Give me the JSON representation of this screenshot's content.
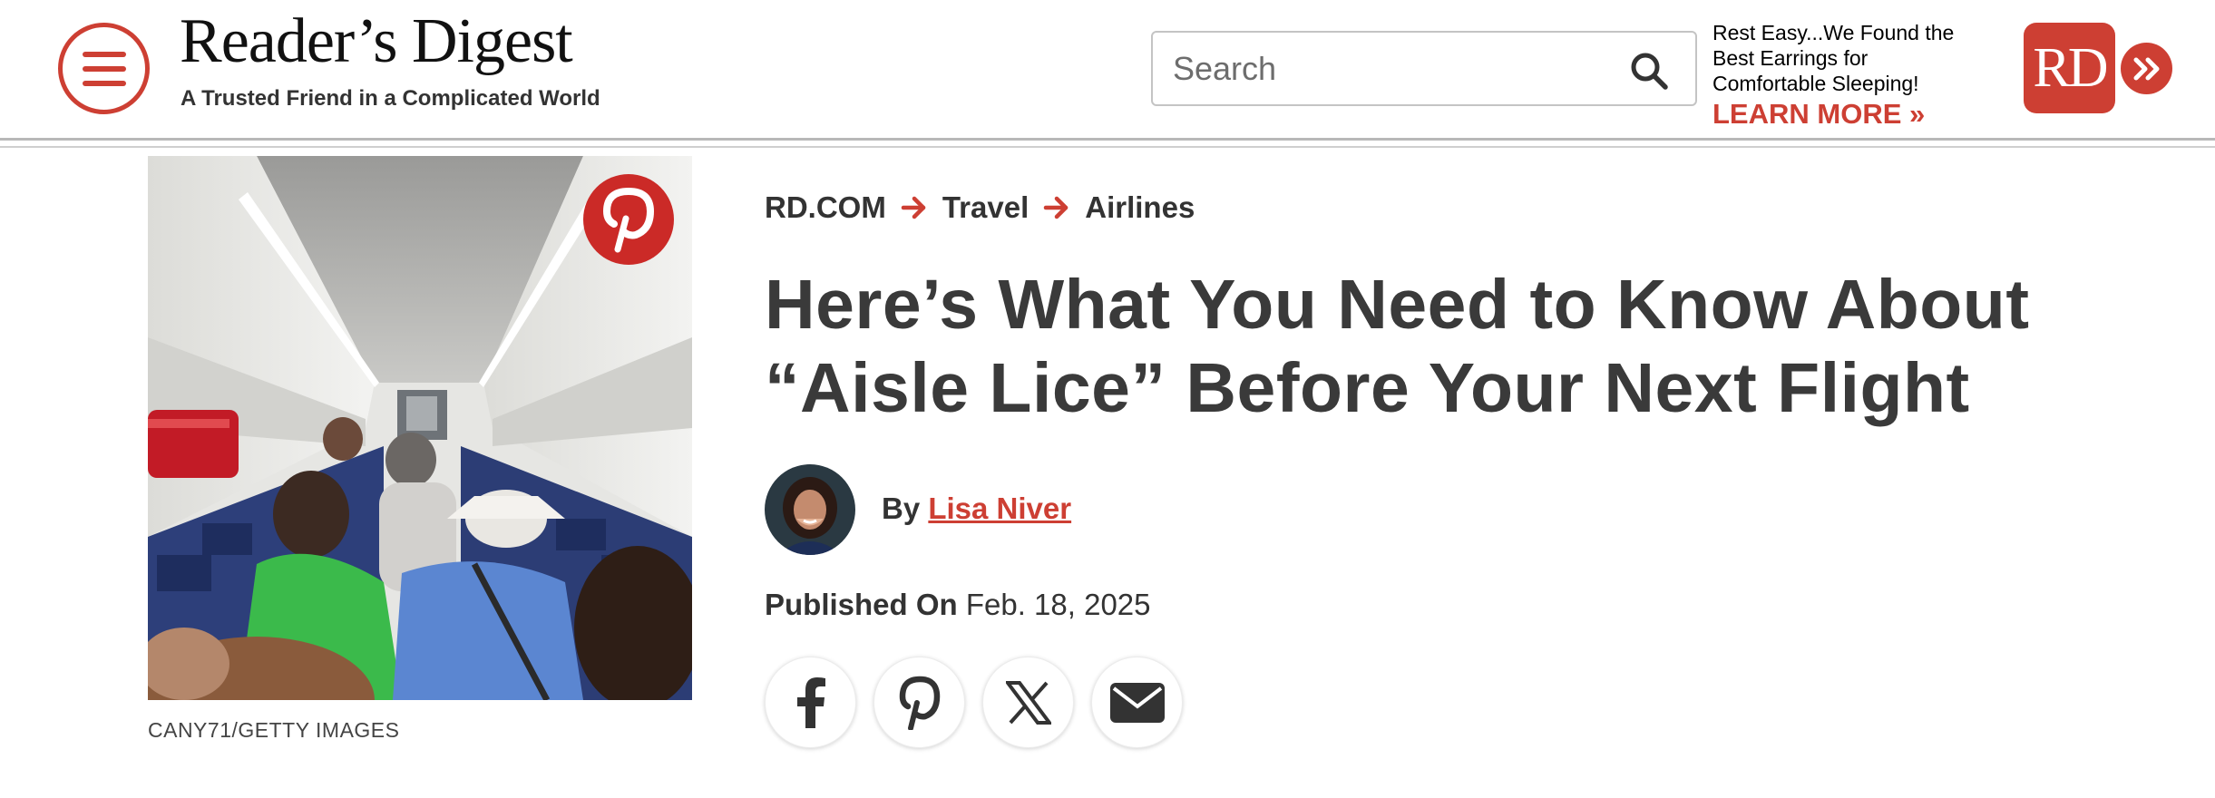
{
  "header": {
    "logo_title": "Reader’s Digest",
    "logo_tagline": "A Trusted Friend in a Complicated World",
    "search_placeholder": "Search",
    "ad": {
      "line1": "Rest Easy...We Found the",
      "line2": "Best Earrings for",
      "line3": "Comfortable Sleeping!",
      "cta": "LEARN MORE »"
    },
    "badge_text": "RD"
  },
  "hero": {
    "credit": "CANY71/GETTY IMAGES"
  },
  "article": {
    "breadcrumb": [
      "RD.COM",
      "Travel",
      "Airlines"
    ],
    "headline": "Here’s What You Need to Know About “Aisle Lice” Before Your Next Flight",
    "byline_prefix": "By",
    "author": "Lisa Niver",
    "published_label": "Published On",
    "published_date": "Feb. 18, 2025"
  },
  "share": [
    {
      "icon": "facebook-icon"
    },
    {
      "icon": "pinterest-icon"
    },
    {
      "icon": "x-icon"
    },
    {
      "icon": "email-icon"
    }
  ],
  "colors": {
    "brand_red": "#cd3f33",
    "text_dark": "#333333",
    "pinterest_red": "#cb2a27"
  }
}
